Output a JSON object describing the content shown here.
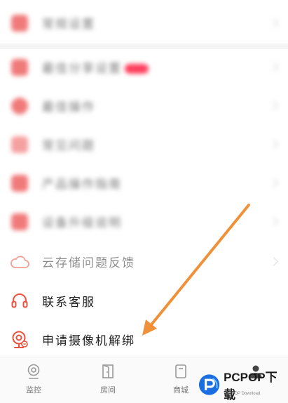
{
  "menu": {
    "items": [
      {
        "label": "常规设置"
      },
      {
        "label": "最佳分享设置"
      },
      {
        "label": "最佳操作"
      },
      {
        "label": "常见问题"
      },
      {
        "label": "产品操作指南"
      },
      {
        "label": "设备升级说明"
      },
      {
        "label": "云存储问题反馈"
      },
      {
        "label": "联系客服"
      },
      {
        "label": "申请摄像机解绑"
      }
    ]
  },
  "tabbar": {
    "tabs": [
      {
        "label": "监控"
      },
      {
        "label": "房间"
      },
      {
        "label": "商城"
      }
    ]
  },
  "watermark": {
    "text": "PCPOP下载",
    "sub": "PCPOP Download"
  },
  "colors": {
    "accent": "#e8533f",
    "arrow": "#f0913a",
    "icon_blurred": "#f07a7a"
  }
}
